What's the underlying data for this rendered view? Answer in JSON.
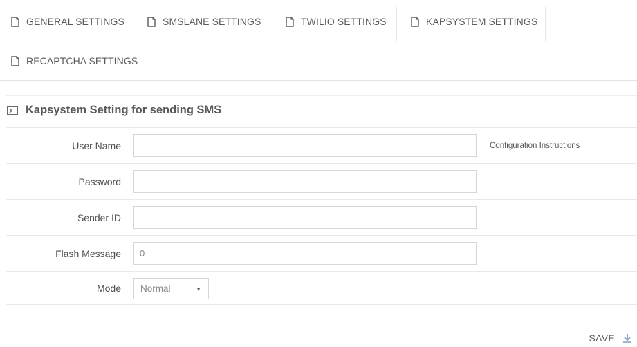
{
  "tabs": [
    {
      "label": "GENERAL SETTINGS"
    },
    {
      "label": "SMSLANE SETTINGS"
    },
    {
      "label": "TWILIO SETTINGS"
    },
    {
      "label": "KAPSYSTEM SETTINGS",
      "active": true
    },
    {
      "label": "RECAPTCHA SETTINGS"
    }
  ],
  "panel": {
    "title": "Kapsystem Setting for sending SMS",
    "icon": "terminal-icon"
  },
  "form": {
    "user_name": {
      "label": "User Name",
      "value": ""
    },
    "password": {
      "label": "Password",
      "value": ""
    },
    "sender_id": {
      "label": "Sender ID",
      "value": ""
    },
    "flash_message": {
      "label": "Flash Message",
      "value": "0"
    },
    "mode": {
      "label": "Mode",
      "value": "Normal"
    },
    "help_link": "Configuration Instructions"
  },
  "actions": {
    "save_label": "SAVE",
    "save_icon": "download-icon"
  },
  "colors": {
    "text": "#555555",
    "border": "#e9e9e9",
    "input_border": "#d6d6d6"
  }
}
